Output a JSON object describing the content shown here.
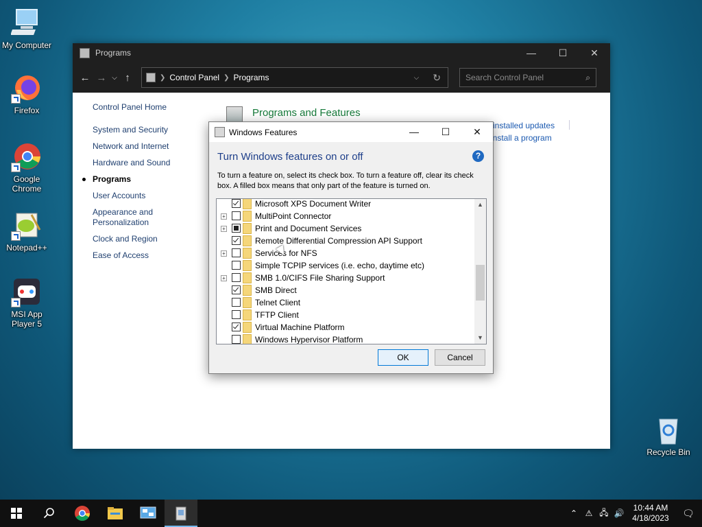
{
  "desktop": {
    "icons": [
      {
        "label": "My Computer"
      },
      {
        "label": "Firefox"
      },
      {
        "label": "Google Chrome"
      },
      {
        "label": "Notepad++"
      },
      {
        "label": "MSI App Player 5"
      },
      {
        "label": "Recycle Bin"
      }
    ]
  },
  "explorer": {
    "title": "Programs",
    "address": [
      "Control Panel",
      "Programs"
    ],
    "search_placeholder": "Search Control Panel",
    "left_nav": {
      "home": "Control Panel Home",
      "items": [
        "System and Security",
        "Network and Internet",
        "Hardware and Sound",
        "Programs",
        "User Accounts",
        "Appearance and Personalization",
        "Clock and Region",
        "Ease of Access"
      ],
      "active": "Programs"
    },
    "section_title": "Programs and Features",
    "link_view_updates": "w installed updates",
    "link_install": "install a program"
  },
  "dialog": {
    "title": "Windows Features",
    "heading": "Turn Windows features on or off",
    "help": "?",
    "description": "To turn a feature on, select its check box. To turn a feature off, clear its check box. A filled box means that only part of the feature is turned on.",
    "features": [
      {
        "label": "Microsoft XPS Document Writer",
        "state": "checked",
        "expandable": false
      },
      {
        "label": "MultiPoint Connector",
        "state": "unchecked",
        "expandable": true
      },
      {
        "label": "Print and Document Services",
        "state": "partial",
        "expandable": true
      },
      {
        "label": "Remote Differential Compression API Support",
        "state": "checked",
        "expandable": false
      },
      {
        "label": "Services for NFS",
        "state": "unchecked",
        "expandable": true
      },
      {
        "label": "Simple TCPIP services (i.e. echo, daytime etc)",
        "state": "unchecked",
        "expandable": false
      },
      {
        "label": "SMB 1.0/CIFS File Sharing Support",
        "state": "unchecked",
        "expandable": true
      },
      {
        "label": "SMB Direct",
        "state": "checked",
        "expandable": false
      },
      {
        "label": "Telnet Client",
        "state": "unchecked",
        "expandable": false
      },
      {
        "label": "TFTP Client",
        "state": "unchecked",
        "expandable": false
      },
      {
        "label": "Virtual Machine Platform",
        "state": "checked",
        "expandable": false
      },
      {
        "label": "Windows Hypervisor Platform",
        "state": "unchecked",
        "expandable": false
      }
    ],
    "ok": "OK",
    "cancel": "Cancel"
  },
  "taskbar": {
    "time": "10:44 AM",
    "date": "4/18/2023"
  }
}
